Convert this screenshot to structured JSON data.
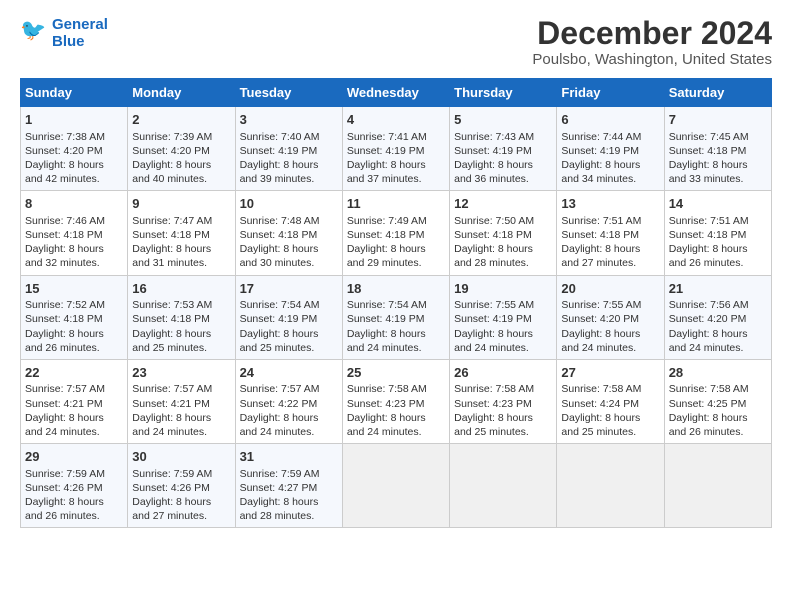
{
  "logo": {
    "line1": "General",
    "line2": "Blue"
  },
  "title": "December 2024",
  "subtitle": "Poulsbo, Washington, United States",
  "days_of_week": [
    "Sunday",
    "Monday",
    "Tuesday",
    "Wednesday",
    "Thursday",
    "Friday",
    "Saturday"
  ],
  "weeks": [
    [
      {
        "day": 1,
        "text": "Sunrise: 7:38 AM\nSunset: 4:20 PM\nDaylight: 8 hours\nand 42 minutes."
      },
      {
        "day": 2,
        "text": "Sunrise: 7:39 AM\nSunset: 4:20 PM\nDaylight: 8 hours\nand 40 minutes."
      },
      {
        "day": 3,
        "text": "Sunrise: 7:40 AM\nSunset: 4:19 PM\nDaylight: 8 hours\nand 39 minutes."
      },
      {
        "day": 4,
        "text": "Sunrise: 7:41 AM\nSunset: 4:19 PM\nDaylight: 8 hours\nand 37 minutes."
      },
      {
        "day": 5,
        "text": "Sunrise: 7:43 AM\nSunset: 4:19 PM\nDaylight: 8 hours\nand 36 minutes."
      },
      {
        "day": 6,
        "text": "Sunrise: 7:44 AM\nSunset: 4:19 PM\nDaylight: 8 hours\nand 34 minutes."
      },
      {
        "day": 7,
        "text": "Sunrise: 7:45 AM\nSunset: 4:18 PM\nDaylight: 8 hours\nand 33 minutes."
      }
    ],
    [
      {
        "day": 8,
        "text": "Sunrise: 7:46 AM\nSunset: 4:18 PM\nDaylight: 8 hours\nand 32 minutes."
      },
      {
        "day": 9,
        "text": "Sunrise: 7:47 AM\nSunset: 4:18 PM\nDaylight: 8 hours\nand 31 minutes."
      },
      {
        "day": 10,
        "text": "Sunrise: 7:48 AM\nSunset: 4:18 PM\nDaylight: 8 hours\nand 30 minutes."
      },
      {
        "day": 11,
        "text": "Sunrise: 7:49 AM\nSunset: 4:18 PM\nDaylight: 8 hours\nand 29 minutes."
      },
      {
        "day": 12,
        "text": "Sunrise: 7:50 AM\nSunset: 4:18 PM\nDaylight: 8 hours\nand 28 minutes."
      },
      {
        "day": 13,
        "text": "Sunrise: 7:51 AM\nSunset: 4:18 PM\nDaylight: 8 hours\nand 27 minutes."
      },
      {
        "day": 14,
        "text": "Sunrise: 7:51 AM\nSunset: 4:18 PM\nDaylight: 8 hours\nand 26 minutes."
      }
    ],
    [
      {
        "day": 15,
        "text": "Sunrise: 7:52 AM\nSunset: 4:18 PM\nDaylight: 8 hours\nand 26 minutes."
      },
      {
        "day": 16,
        "text": "Sunrise: 7:53 AM\nSunset: 4:18 PM\nDaylight: 8 hours\nand 25 minutes."
      },
      {
        "day": 17,
        "text": "Sunrise: 7:54 AM\nSunset: 4:19 PM\nDaylight: 8 hours\nand 25 minutes."
      },
      {
        "day": 18,
        "text": "Sunrise: 7:54 AM\nSunset: 4:19 PM\nDaylight: 8 hours\nand 24 minutes."
      },
      {
        "day": 19,
        "text": "Sunrise: 7:55 AM\nSunset: 4:19 PM\nDaylight: 8 hours\nand 24 minutes."
      },
      {
        "day": 20,
        "text": "Sunrise: 7:55 AM\nSunset: 4:20 PM\nDaylight: 8 hours\nand 24 minutes."
      },
      {
        "day": 21,
        "text": "Sunrise: 7:56 AM\nSunset: 4:20 PM\nDaylight: 8 hours\nand 24 minutes."
      }
    ],
    [
      {
        "day": 22,
        "text": "Sunrise: 7:57 AM\nSunset: 4:21 PM\nDaylight: 8 hours\nand 24 minutes."
      },
      {
        "day": 23,
        "text": "Sunrise: 7:57 AM\nSunset: 4:21 PM\nDaylight: 8 hours\nand 24 minutes."
      },
      {
        "day": 24,
        "text": "Sunrise: 7:57 AM\nSunset: 4:22 PM\nDaylight: 8 hours\nand 24 minutes."
      },
      {
        "day": 25,
        "text": "Sunrise: 7:58 AM\nSunset: 4:23 PM\nDaylight: 8 hours\nand 24 minutes."
      },
      {
        "day": 26,
        "text": "Sunrise: 7:58 AM\nSunset: 4:23 PM\nDaylight: 8 hours\nand 25 minutes."
      },
      {
        "day": 27,
        "text": "Sunrise: 7:58 AM\nSunset: 4:24 PM\nDaylight: 8 hours\nand 25 minutes."
      },
      {
        "day": 28,
        "text": "Sunrise: 7:58 AM\nSunset: 4:25 PM\nDaylight: 8 hours\nand 26 minutes."
      }
    ],
    [
      {
        "day": 29,
        "text": "Sunrise: 7:59 AM\nSunset: 4:26 PM\nDaylight: 8 hours\nand 26 minutes."
      },
      {
        "day": 30,
        "text": "Sunrise: 7:59 AM\nSunset: 4:26 PM\nDaylight: 8 hours\nand 27 minutes."
      },
      {
        "day": 31,
        "text": "Sunrise: 7:59 AM\nSunset: 4:27 PM\nDaylight: 8 hours\nand 28 minutes."
      },
      null,
      null,
      null,
      null
    ]
  ]
}
